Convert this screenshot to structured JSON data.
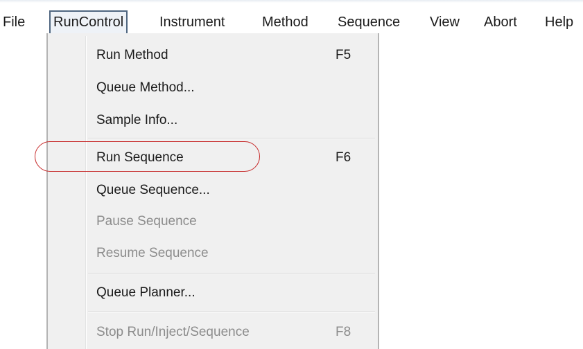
{
  "menubar": {
    "items": [
      {
        "label": "File"
      },
      {
        "label": "RunControl"
      },
      {
        "label": "Instrument"
      },
      {
        "label": "Method"
      },
      {
        "label": "Sequence"
      },
      {
        "label": "View"
      },
      {
        "label": "Abort"
      },
      {
        "label": "Help"
      }
    ],
    "active_menu": "RunControl"
  },
  "runcontrol_menu": {
    "items": [
      {
        "label": "Run Method",
        "shortcut": "F5",
        "enabled": true
      },
      {
        "label": "Queue Method...",
        "shortcut": "",
        "enabled": true
      },
      {
        "label": "Sample Info...",
        "shortcut": "",
        "enabled": true
      },
      {
        "label": "Run Sequence",
        "shortcut": "F6",
        "enabled": true,
        "highlighted": true
      },
      {
        "label": "Queue Sequence...",
        "shortcut": "",
        "enabled": true
      },
      {
        "label": "Pause Sequence",
        "shortcut": "",
        "enabled": false
      },
      {
        "label": "Resume Sequence",
        "shortcut": "",
        "enabled": false
      },
      {
        "label": "Queue Planner...",
        "shortcut": "",
        "enabled": true
      },
      {
        "label": "Stop Run/Inject/Sequence",
        "shortcut": "F8",
        "enabled": false
      }
    ]
  },
  "colors": {
    "highlight_ellipse": "#c62828",
    "disabled_text": "#8c8c8c",
    "menu_background": "#f0f0f0"
  }
}
